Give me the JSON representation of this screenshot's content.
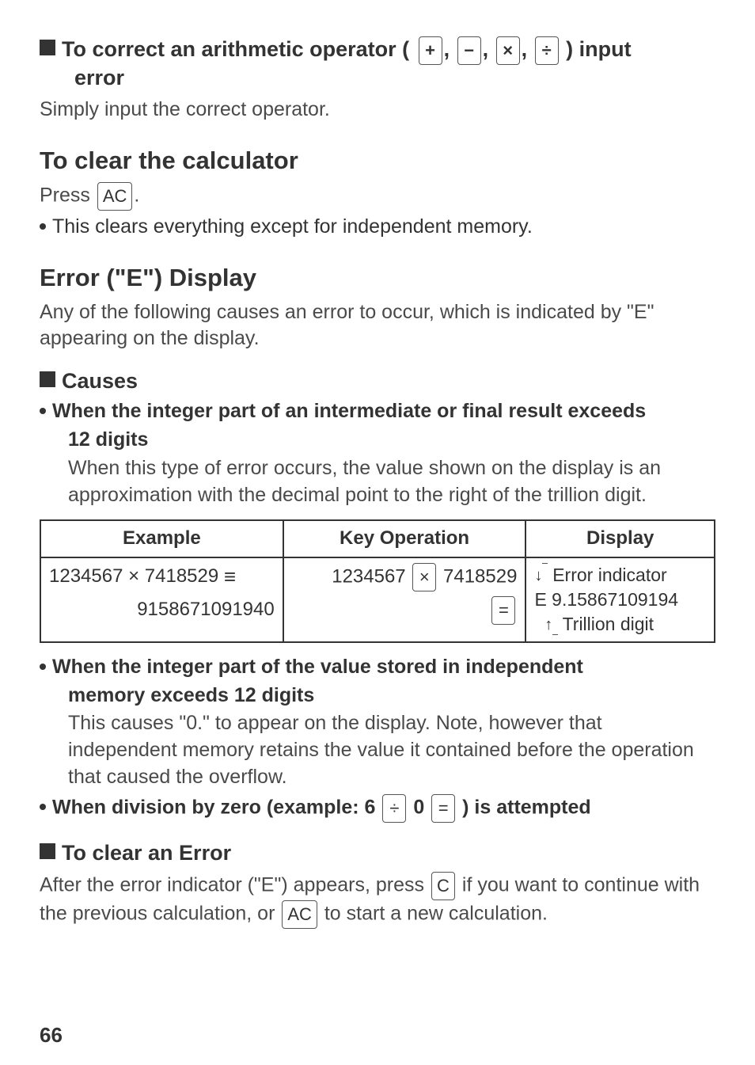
{
  "section1": {
    "heading_prefix": "To correct an arithmetic operator (",
    "heading_suffix": ") input",
    "heading_line2": "error",
    "ops": {
      "plus": "+",
      "minus": "−",
      "times": "×",
      "divide": "÷"
    },
    "body": "Simply input the correct operator."
  },
  "section2": {
    "title": "To clear the calculator",
    "press_label": "Press",
    "key_ac": "AC",
    "dot_after": ".",
    "bullet": "This clears everything except for independent memory."
  },
  "section3": {
    "title": "Error (\"E\") Display",
    "body": "Any of the following causes an error to occur, which is indicated by \"E\" appearing on the display."
  },
  "causes_heading": "Causes",
  "cause1": {
    "bold1": "When the integer part of an intermediate or final result exceeds",
    "bold2": "12 digits",
    "body": "When this type of error occurs, the value shown on the display is an approximation with the decimal point to the right of the trillion digit."
  },
  "table": {
    "headers": {
      "example": "Example",
      "keyop": "Key Operation",
      "display": "Display"
    },
    "row": {
      "expr_a": "1234567 × 7418529",
      "expr_result": "9158671091940",
      "key_a": "1234567",
      "key_op": "×",
      "key_b": "7418529",
      "key_eq": "=",
      "disp_err_label": "Error indicator",
      "disp_value": "E 9.15867109194",
      "disp_trillion": "Trillion digit"
    }
  },
  "cause2": {
    "bold1": "When the integer part of the value stored in independent",
    "bold2": "memory exceeds 12 digits",
    "body": "This causes \"0.\" to appear on the display. Note, however that independent memory retains the value it contained before the operation that caused the overflow."
  },
  "cause3": {
    "prefix": "When division by zero (example: 6",
    "op_div": "÷",
    "zero": "0",
    "op_eq": "=",
    "suffix": ") is attempted"
  },
  "clear_error": {
    "heading": "To clear an Error",
    "p1a": "After the error indicator (\"E\") appears, press",
    "key_c": "C",
    "p1b": "if you want to continue with the previous calculation, or",
    "key_ac": "AC",
    "p1c": "to start a new calculation."
  },
  "page_number": "66"
}
